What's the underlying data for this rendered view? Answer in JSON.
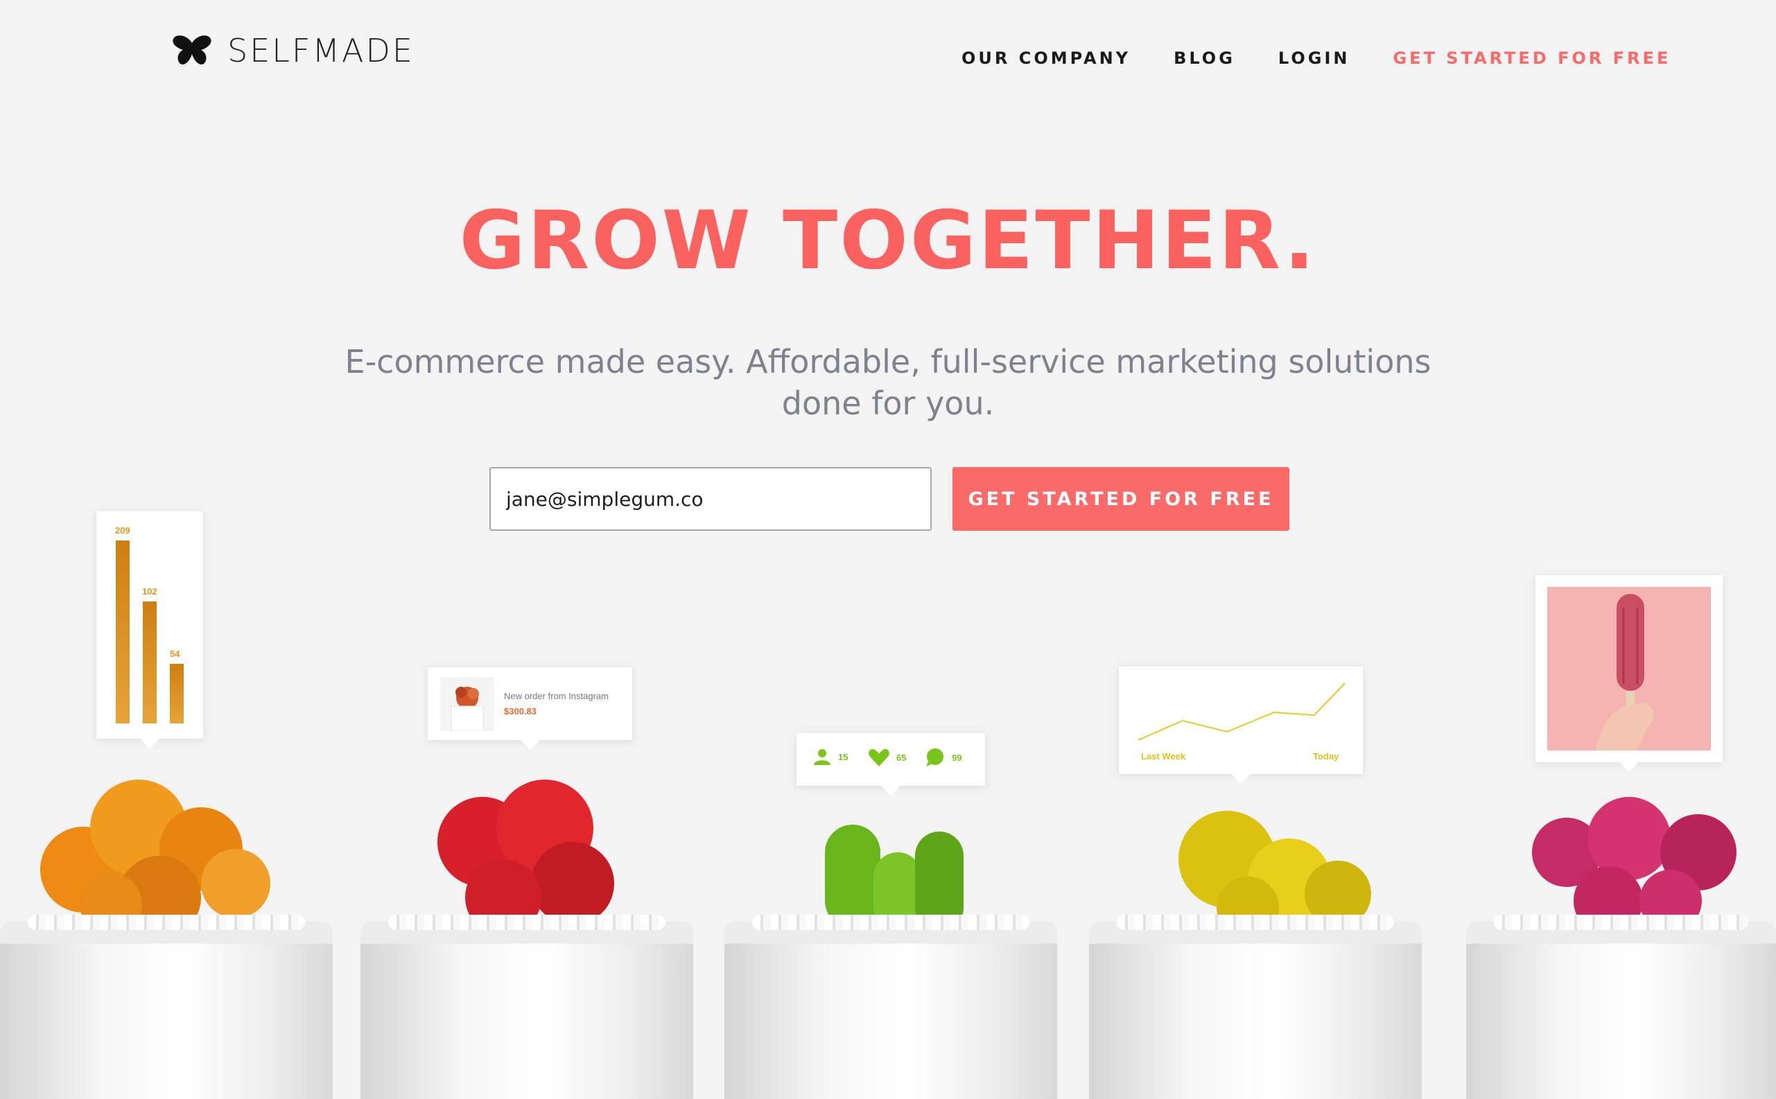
{
  "brand": {
    "name": "SELFMADE",
    "logo_icon": "butterfly-icon"
  },
  "nav": {
    "items": [
      "OUR COMPANY",
      "BLOG",
      "LOGIN"
    ],
    "cta": "GET STARTED FOR FREE"
  },
  "hero": {
    "headline": "GROW TOGETHER.",
    "subtitle": "E-commerce made easy. Affordable, full-service marketing solutions done for you."
  },
  "signup": {
    "email_value": "jane@simplegum.co",
    "button_label": "GET STARTED FOR FREE"
  },
  "cards": {
    "bars": {
      "values": [
        209,
        102,
        54
      ],
      "labels": [
        "209",
        "102",
        "54"
      ]
    },
    "order": {
      "title": "New order from Instagram",
      "amount": "$300.83"
    },
    "social": {
      "followers": "15",
      "likes": "65",
      "comments": "99"
    },
    "trend": {
      "start_label": "Last Week",
      "end_label": "Today"
    }
  },
  "colors": {
    "accent": "#fa6a69",
    "headline": "#f9625e",
    "subtitle": "#7d828c",
    "cactus_orange": "#ef8a12",
    "cactus_red": "#d8202a",
    "cactus_green": "#69b51c",
    "cactus_yellow": "#dcc210",
    "cactus_magenta": "#c52b64"
  }
}
